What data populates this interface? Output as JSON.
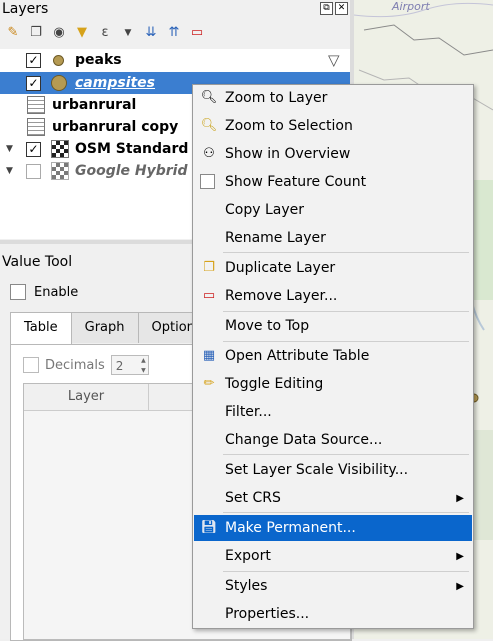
{
  "layers_panel": {
    "title": "Layers",
    "title_buttons": [
      "⧉",
      "✕"
    ],
    "toolbar_icons": [
      "paint-brush-icon",
      "add-group-icon",
      "eye-icon",
      "filter-icon",
      "epsilon-icon",
      "dropdown-icon",
      "expand-all-icon",
      "collapse-all-icon",
      "remove-layer-icon"
    ],
    "layers": [
      {
        "name": "peaks",
        "checked": true,
        "icon": "point-icon"
      },
      {
        "name": "campsites",
        "checked": true,
        "icon": "point-icon",
        "selected": true
      },
      {
        "name": "urbanrural",
        "checked": null,
        "icon": "table-icon"
      },
      {
        "name": "urbanrural copy",
        "checked": null,
        "icon": "table-icon"
      },
      {
        "name": "OSM Standard",
        "checked": true,
        "icon": "raster-icon"
      },
      {
        "name": "Google Hybrid",
        "checked": false,
        "icon": "raster-icon"
      }
    ]
  },
  "value_tool": {
    "title": "Value Tool",
    "enable_label": "Enable",
    "tabs": [
      "Table",
      "Graph",
      "Options"
    ],
    "decimals_label": "Decimals",
    "decimals_value": "2",
    "column_layer": "Layer"
  },
  "map": {
    "label": "Airport"
  },
  "context_menu": {
    "items": [
      {
        "label": "Zoom to Layer",
        "icon": "zoom-layer-icon"
      },
      {
        "label": "Zoom to Selection",
        "icon": "zoom-selection-icon"
      },
      {
        "label": "Show in Overview",
        "icon": "overview-icon"
      },
      {
        "label": "Show Feature Count",
        "icon": "checkbox-icon"
      },
      {
        "label": "Copy Layer",
        "icon": ""
      },
      {
        "label": "Rename Layer",
        "icon": ""
      },
      {
        "label": "Duplicate Layer",
        "icon": "duplicate-icon"
      },
      {
        "label": "Remove Layer...",
        "icon": "remove-icon"
      },
      {
        "label": "Move to Top",
        "icon": ""
      },
      {
        "label": "Open Attribute Table",
        "icon": "table-icon"
      },
      {
        "label": "Toggle Editing",
        "icon": "pencil-icon"
      },
      {
        "label": "Filter...",
        "icon": ""
      },
      {
        "label": "Change Data Source...",
        "icon": ""
      },
      {
        "label": "Set Layer Scale Visibility...",
        "icon": ""
      },
      {
        "label": "Set CRS",
        "icon": "",
        "submenu": true
      },
      {
        "label": "Make Permanent...",
        "icon": "save-icon",
        "highlighted": true
      },
      {
        "label": "Export",
        "icon": "",
        "submenu": true
      },
      {
        "label": "Styles",
        "icon": "",
        "submenu": true
      },
      {
        "label": "Properties...",
        "icon": ""
      }
    ]
  }
}
